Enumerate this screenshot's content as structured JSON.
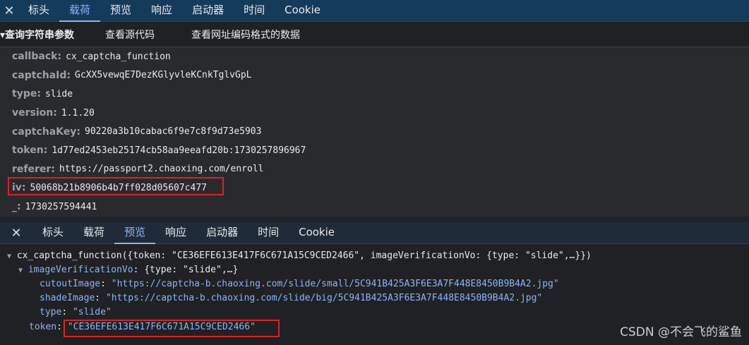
{
  "top_tabs": {
    "close": "✕",
    "items": [
      "标头",
      "载荷",
      "预览",
      "响应",
      "启动器",
      "时间",
      "Cookie"
    ],
    "active_index": 1
  },
  "toolbar": {
    "section": "▾查询字符串参数",
    "view_source": "查看源代码",
    "view_encoded": "查看网址编码格式的数据"
  },
  "params": [
    {
      "key": "callback:",
      "value": "cx_captcha_function"
    },
    {
      "key": "captchaId:",
      "value": "GcXX5vewqE7DezKGlyvleKCnkTglvGpL"
    },
    {
      "key": "type:",
      "value": "slide"
    },
    {
      "key": "version:",
      "value": "1.1.20"
    },
    {
      "key": "captchaKey:",
      "value": "90220a3b10cabac6f9e7c8f9d73e5903"
    },
    {
      "key": "token:",
      "value": "1d77ed2453eb25174cb58aa9eeafd20b:1730257896967"
    },
    {
      "key": "referer:",
      "value": "https://passport2.chaoxing.com/enroll"
    },
    {
      "key": "iv:",
      "value": "50068b21b8906b4b7ff028d05607c477"
    },
    {
      "key": "_:",
      "value": "1730257594441"
    }
  ],
  "bottom_tabs": {
    "close": "✕",
    "items": [
      "标头",
      "载荷",
      "预览",
      "响应",
      "启动器",
      "时间",
      "Cookie"
    ],
    "active_index": 2
  },
  "preview": {
    "root_prefix": "cx_captcha_function({token: ",
    "root_token": "\"CE36EFE613E417F6C671A15C9CED2466\"",
    "root_mid": ", imageVerificationVo: {type: ",
    "root_type": "\"slide\"",
    "root_suffix": ",…}})",
    "ivv_key": "imageVerificationVo",
    "ivv_summary_a": ": {type: ",
    "ivv_summary_type": "\"slide\"",
    "ivv_summary_b": ",…}",
    "cutout_key": "cutoutImage",
    "cutout_val": "\"https://captcha-b.chaoxing.com/slide/small/5C941B425A3F6E3A7F448E8450B9B4A2.jpg\"",
    "shade_key": "shadeImage",
    "shade_val": "\"https://captcha-b.chaoxing.com/slide/big/5C941B425A3F6E3A7F448E8450B9B4A2.jpg\"",
    "type_key": "type",
    "type_val": "\"slide\"",
    "token_key": "token",
    "token_val": "\"CE36EFE613E417F6C671A15C9CED2466\""
  },
  "watermark": "CSDN @不会飞的鲨鱼"
}
